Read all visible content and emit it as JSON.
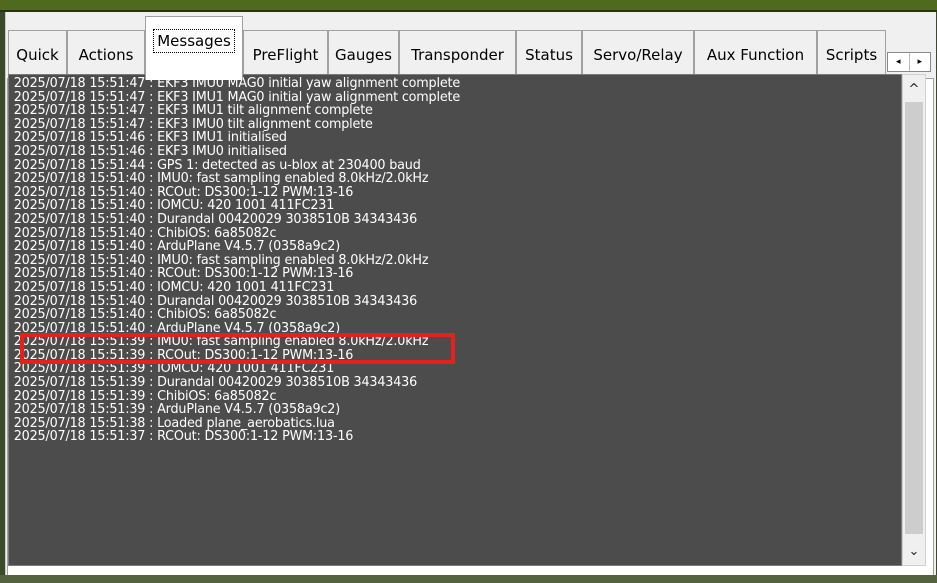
{
  "tabs": [
    {
      "label": "Quick",
      "name": "tab-quick",
      "active": false
    },
    {
      "label": "Actions",
      "name": "tab-actions",
      "active": false
    },
    {
      "label": "Messages",
      "name": "tab-messages",
      "active": true
    },
    {
      "label": "PreFlight",
      "name": "tab-preflight",
      "active": false
    },
    {
      "label": "Gauges",
      "name": "tab-gauges",
      "active": false
    },
    {
      "label": "Transponder",
      "name": "tab-transponder",
      "active": false
    },
    {
      "label": "Status",
      "name": "tab-status",
      "active": false
    },
    {
      "label": "Servo/Relay",
      "name": "tab-servo-relay",
      "active": false
    },
    {
      "label": "Aux Function",
      "name": "tab-aux-function",
      "active": false
    },
    {
      "label": "Scripts",
      "name": "tab-scripts",
      "active": false
    }
  ],
  "tab_scroll": {
    "left": "◂",
    "right": "▸"
  },
  "scrollbar": {
    "up": "^",
    "down": "⌄"
  },
  "messages": [
    "2025/07/18 15:51:47 : EKF3 IMU0 MAG0 initial yaw alignment complete",
    "2025/07/18 15:51:47 : EKF3 IMU1 MAG0 initial yaw alignment complete",
    "2025/07/18 15:51:47 : EKF3 IMU1 tilt alignment complete",
    "2025/07/18 15:51:47 : EKF3 IMU0 tilt alignment complete",
    "2025/07/18 15:51:46 : EKF3 IMU1 initialised",
    "2025/07/18 15:51:46 : EKF3 IMU0 initialised",
    "2025/07/18 15:51:44 : GPS 1: detected as u-blox at 230400 baud",
    "2025/07/18 15:51:40 : IMU0: fast sampling enabled 8.0kHz/2.0kHz",
    "2025/07/18 15:51:40 : RCOut: DS300:1-12 PWM:13-16",
    "2025/07/18 15:51:40 : IOMCU: 420 1001 411FC231",
    "2025/07/18 15:51:40 : Durandal 00420029 3038510B 34343436",
    "2025/07/18 15:51:40 : ChibiOS: 6a85082c",
    "2025/07/18 15:51:40 : ArduPlane V4.5.7 (0358a9c2)",
    "2025/07/18 15:51:40 : IMU0: fast sampling enabled 8.0kHz/2.0kHz",
    "2025/07/18 15:51:40 : RCOut: DS300:1-12 PWM:13-16",
    "2025/07/18 15:51:40 : IOMCU: 420 1001 411FC231",
    "2025/07/18 15:51:40 : Durandal 00420029 3038510B 34343436",
    "2025/07/18 15:51:40 : ChibiOS: 6a85082c",
    "2025/07/18 15:51:40 : ArduPlane V4.5.7 (0358a9c2)",
    "2025/07/18 15:51:39 : IMU0: fast sampling enabled 8.0kHz/2.0kHz",
    "2025/07/18 15:51:39 : RCOut: DS300:1-12 PWM:13-16",
    "2025/07/18 15:51:39 : IOMCU: 420 1001 411FC231",
    "2025/07/18 15:51:39 : Durandal 00420029 3038510B 34343436",
    "2025/07/18 15:51:39 : ChibiOS: 6a85082c",
    "2025/07/18 15:51:39 : ArduPlane V4.5.7 (0358a9c2)",
    "2025/07/18 15:51:38 : Loaded plane_aerobatics.lua",
    "2025/07/18 15:51:37 : RCOut: DS300:1-12 PWM:13-16"
  ],
  "highlight": {
    "color": "#e8201b",
    "message_index": 14
  }
}
